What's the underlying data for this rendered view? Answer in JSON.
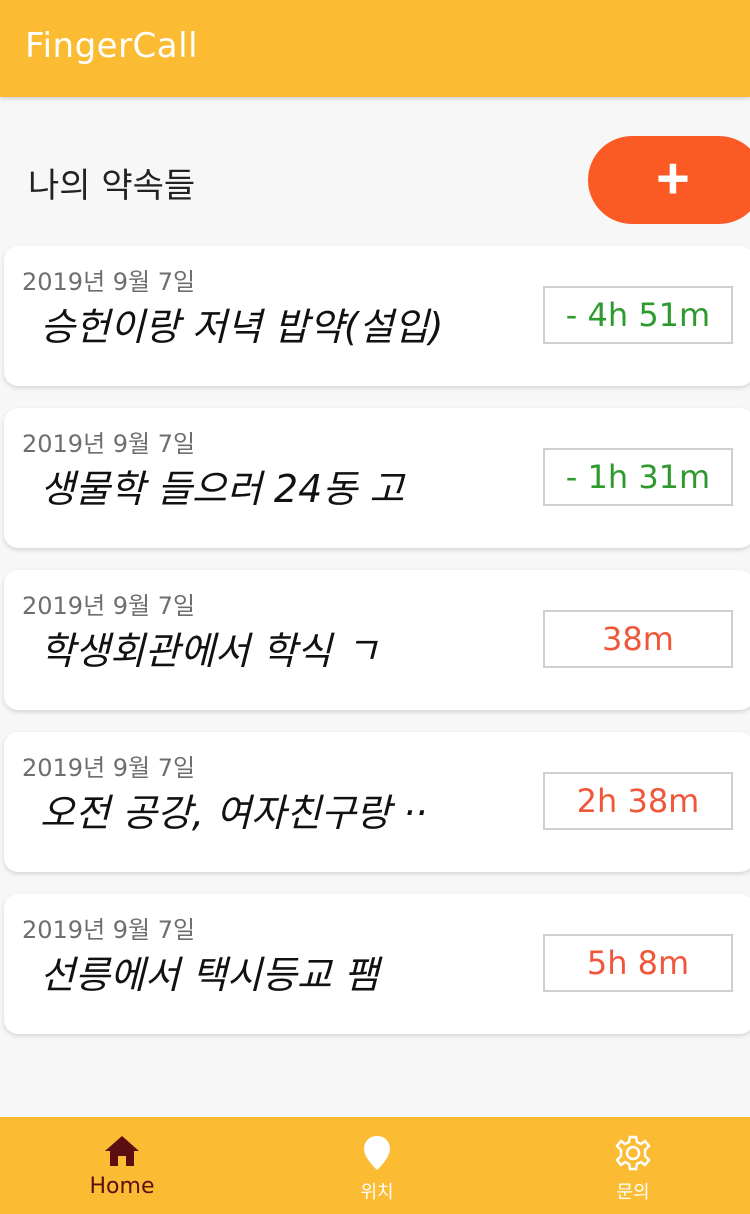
{
  "appbar": {
    "title": "FingerCall"
  },
  "section": {
    "title": "나의 약속들",
    "add_label": "+"
  },
  "appointments": [
    {
      "date": "2019년 9월 7일",
      "title": "승헌이랑 저녁 밥약(설입)",
      "time": "- 4h 51m",
      "status": "past"
    },
    {
      "date": "2019년 9월 7일",
      "title": "생물학 들으러 24동 고",
      "time": "- 1h 31m",
      "status": "past"
    },
    {
      "date": "2019년 9월 7일",
      "title": "학생회관에서 학식 ㄱ",
      "time": "38m",
      "status": "upcoming"
    },
    {
      "date": "2019년 9월 7일",
      "title": "오전 공강, 여자친구랑 ··",
      "time": "2h 38m",
      "status": "upcoming"
    },
    {
      "date": "2019년 9월 7일",
      "title": "선릉에서 택시등교 팸",
      "time": "5h 8m",
      "status": "upcoming"
    }
  ],
  "colors": {
    "primary": "#fbbb33",
    "accent": "#fc5a24",
    "past": "#2e9a2e",
    "upcoming": "#f0573a",
    "nav_active": "#5c0f12"
  },
  "bottom_nav": [
    {
      "label": "Home",
      "icon": "home-icon",
      "active": true
    },
    {
      "label": "위치",
      "icon": "location-pin-icon",
      "active": false
    },
    {
      "label": "문의",
      "icon": "gear-icon",
      "active": false
    }
  ]
}
